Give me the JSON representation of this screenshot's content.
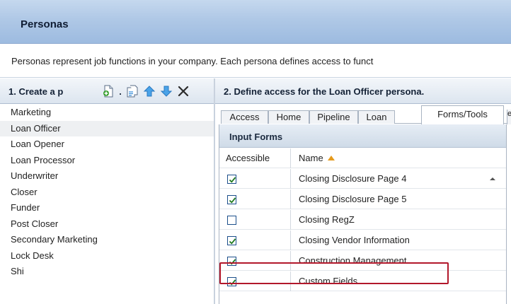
{
  "window": {
    "title": "Personas"
  },
  "description": "Personas represent job functions in your company. Each persona defines access to funct",
  "left_pane": {
    "header_label_prefix": "1. Create a p",
    "header_label_mid": ".",
    "toolbar_icons": [
      "new-persona-icon",
      "copy-persona-icon",
      "move-up-icon",
      "move-down-icon",
      "delete-icon"
    ],
    "personas": [
      "Marketing",
      "Loan Officer",
      "Loan Opener",
      "Loan Processor",
      "Underwriter",
      "Closer",
      "Funder",
      "Post Closer",
      "Secondary Marketing",
      "Lock Desk",
      "Shi"
    ],
    "selected_persona": "Loan Officer"
  },
  "right_pane": {
    "header_label": "2. Define access for the Loan Officer persona.",
    "tabs": [
      "Access",
      "Home",
      "Pipeline",
      "Loan",
      "Forms/Tools",
      "e"
    ],
    "active_tab": "Forms/Tools",
    "section_title": "Input Forms",
    "columns": {
      "accessible": "Accessible",
      "name": "Name"
    },
    "sort_color": "#e59a1c",
    "forms": [
      {
        "name": "Closing Disclosure Page 4",
        "accessible": true
      },
      {
        "name": "Closing Disclosure Page 5",
        "accessible": true
      },
      {
        "name": "Closing RegZ",
        "accessible": false
      },
      {
        "name": "Closing Vendor Information",
        "accessible": true
      },
      {
        "name": "Construction Management",
        "accessible": true,
        "highlighted": true
      },
      {
        "name": "Custom Fields",
        "accessible": true
      }
    ],
    "highlight_color": "#b2182b"
  }
}
